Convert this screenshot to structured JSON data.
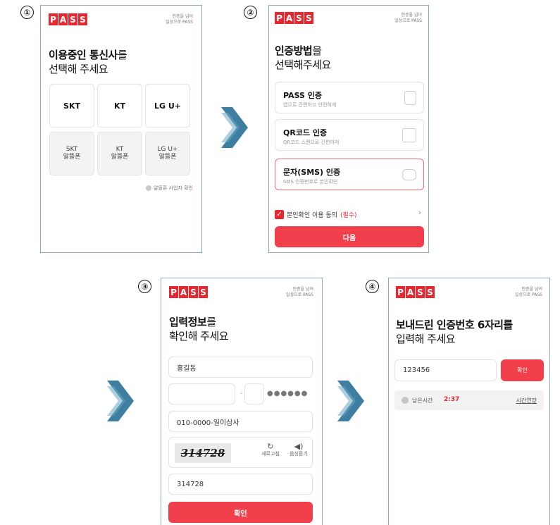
{
  "brand": {
    "logo_letters": [
      "P",
      "A",
      "S",
      "S"
    ],
    "tagline_1": "인증을 넘어",
    "tagline_2": "일상으로 PASS",
    "accent": "#e8262f"
  },
  "steps": [
    "①",
    "②",
    "③",
    "④"
  ],
  "panel1": {
    "heading_bold": "이용중인 통신사",
    "heading_tail": "를",
    "heading_line2": "선택해 주세요",
    "carriers": [
      "SKT",
      "KT",
      "LG U+"
    ],
    "mvno": [
      {
        "line1": "SKT",
        "line2": "알뜰폰"
      },
      {
        "line1": "KT",
        "line2": "알뜰폰"
      },
      {
        "line1": "LG U+",
        "line2": "알뜰폰"
      }
    ],
    "note": "알뜰폰 사업자 확인"
  },
  "panel2": {
    "heading_bold": "인증방법",
    "heading_tail": "을",
    "heading_line2": "선택해주세요",
    "methods": [
      {
        "title": "PASS 인증",
        "sub": "앱으로 간편하고 안전하게"
      },
      {
        "title": "QR코드 인증",
        "sub": "QR코드 스캔으로 간편하게"
      },
      {
        "title": "문자(SMS) 인증",
        "sub": "SMS 인증번호로 본인확인"
      }
    ],
    "agree_label": "본인확인 이용 동의",
    "agree_required": "(필수)",
    "next_label": "다음"
  },
  "panel3": {
    "heading_bold": "입력정보",
    "heading_tail": "를",
    "heading_line2": "확인해 주세요",
    "name_value": "홍길동",
    "rrn_dash": "-",
    "rrn_masked": "●●●●●●",
    "phone_value": "010-0000-일이삼사",
    "captcha_text": "314728",
    "refresh_label": "새로고침",
    "audio_label": "음성듣기",
    "captcha_input": "314728",
    "confirm_label": "확인"
  },
  "panel4": {
    "heading_line1": "보내드린 인증번호 6자리를",
    "heading_line2": "입력해 주세요",
    "code_value": "123456",
    "confirm_label": "확인",
    "timer_label": "남은시간",
    "timer_value": "2:37",
    "extend_label": "시간연장"
  }
}
